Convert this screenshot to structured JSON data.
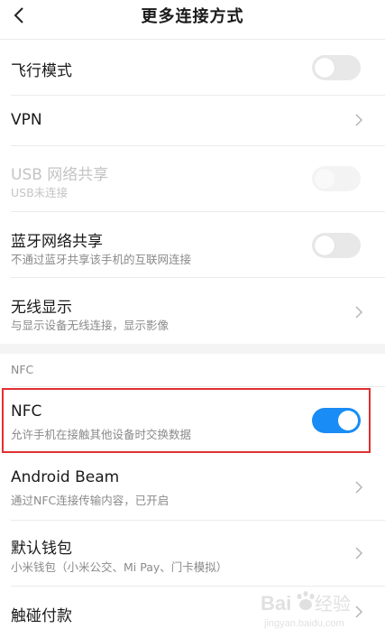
{
  "header": {
    "title": "更多连接方式",
    "back_icon": "chevron-left-icon"
  },
  "rows": {
    "airplane": {
      "label": "飞行模式",
      "toggle": "off"
    },
    "vpn": {
      "label": "VPN"
    },
    "usb_tether": {
      "label": "USB 网络共享",
      "subtitle": "USB未连接",
      "toggle": "off",
      "disabled": true
    },
    "bt_tether": {
      "label": "蓝牙网络共享",
      "subtitle": "不通过蓝牙共享该手机的互联网连接",
      "toggle": "off"
    },
    "wireless_display": {
      "label": "无线显示",
      "subtitle": "与显示设备无线连接，显示影像"
    },
    "nfc": {
      "label": "NFC",
      "subtitle": "允许手机在接触其他设备时交换数据",
      "toggle": "on"
    },
    "android_beam": {
      "label": "Android Beam",
      "subtitle": "通过NFC连接传输内容，已开启"
    },
    "default_wallet": {
      "label": "默认钱包",
      "subtitle": "小米钱包（小米公交、Mi Pay、门卡模拟）"
    },
    "tap_pay": {
      "label": "触碰付款"
    }
  },
  "sections": {
    "nfc_header": "NFC"
  },
  "colors": {
    "accent": "#1a8cf5",
    "highlight_border": "#e03030"
  },
  "watermark": {
    "brand": "Baidu经验",
    "url": "jingyan.baidu.com"
  }
}
